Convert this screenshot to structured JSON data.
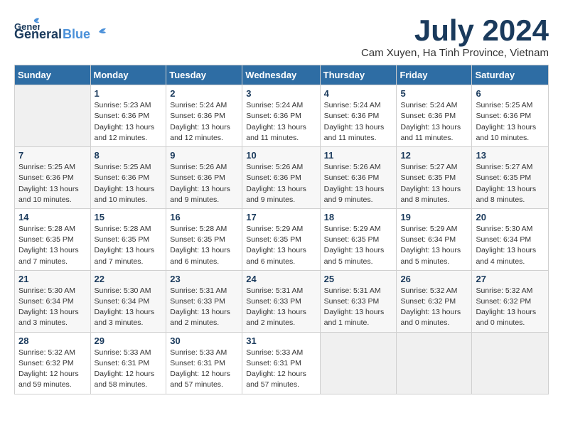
{
  "header": {
    "logo_general": "General",
    "logo_blue": "Blue",
    "month_title": "July 2024",
    "subtitle": "Cam Xuyen, Ha Tinh Province, Vietnam"
  },
  "columns": [
    "Sunday",
    "Monday",
    "Tuesday",
    "Wednesday",
    "Thursday",
    "Friday",
    "Saturday"
  ],
  "weeks": [
    [
      {
        "day": "",
        "info": ""
      },
      {
        "day": "1",
        "info": "Sunrise: 5:23 AM\nSunset: 6:36 PM\nDaylight: 13 hours\nand 12 minutes."
      },
      {
        "day": "2",
        "info": "Sunrise: 5:24 AM\nSunset: 6:36 PM\nDaylight: 13 hours\nand 12 minutes."
      },
      {
        "day": "3",
        "info": "Sunrise: 5:24 AM\nSunset: 6:36 PM\nDaylight: 13 hours\nand 11 minutes."
      },
      {
        "day": "4",
        "info": "Sunrise: 5:24 AM\nSunset: 6:36 PM\nDaylight: 13 hours\nand 11 minutes."
      },
      {
        "day": "5",
        "info": "Sunrise: 5:24 AM\nSunset: 6:36 PM\nDaylight: 13 hours\nand 11 minutes."
      },
      {
        "day": "6",
        "info": "Sunrise: 5:25 AM\nSunset: 6:36 PM\nDaylight: 13 hours\nand 10 minutes."
      }
    ],
    [
      {
        "day": "7",
        "info": "Sunrise: 5:25 AM\nSunset: 6:36 PM\nDaylight: 13 hours\nand 10 minutes."
      },
      {
        "day": "8",
        "info": "Sunrise: 5:25 AM\nSunset: 6:36 PM\nDaylight: 13 hours\nand 10 minutes."
      },
      {
        "day": "9",
        "info": "Sunrise: 5:26 AM\nSunset: 6:36 PM\nDaylight: 13 hours\nand 9 minutes."
      },
      {
        "day": "10",
        "info": "Sunrise: 5:26 AM\nSunset: 6:36 PM\nDaylight: 13 hours\nand 9 minutes."
      },
      {
        "day": "11",
        "info": "Sunrise: 5:26 AM\nSunset: 6:36 PM\nDaylight: 13 hours\nand 9 minutes."
      },
      {
        "day": "12",
        "info": "Sunrise: 5:27 AM\nSunset: 6:35 PM\nDaylight: 13 hours\nand 8 minutes."
      },
      {
        "day": "13",
        "info": "Sunrise: 5:27 AM\nSunset: 6:35 PM\nDaylight: 13 hours\nand 8 minutes."
      }
    ],
    [
      {
        "day": "14",
        "info": "Sunrise: 5:28 AM\nSunset: 6:35 PM\nDaylight: 13 hours\nand 7 minutes."
      },
      {
        "day": "15",
        "info": "Sunrise: 5:28 AM\nSunset: 6:35 PM\nDaylight: 13 hours\nand 7 minutes."
      },
      {
        "day": "16",
        "info": "Sunrise: 5:28 AM\nSunset: 6:35 PM\nDaylight: 13 hours\nand 6 minutes."
      },
      {
        "day": "17",
        "info": "Sunrise: 5:29 AM\nSunset: 6:35 PM\nDaylight: 13 hours\nand 6 minutes."
      },
      {
        "day": "18",
        "info": "Sunrise: 5:29 AM\nSunset: 6:35 PM\nDaylight: 13 hours\nand 5 minutes."
      },
      {
        "day": "19",
        "info": "Sunrise: 5:29 AM\nSunset: 6:34 PM\nDaylight: 13 hours\nand 5 minutes."
      },
      {
        "day": "20",
        "info": "Sunrise: 5:30 AM\nSunset: 6:34 PM\nDaylight: 13 hours\nand 4 minutes."
      }
    ],
    [
      {
        "day": "21",
        "info": "Sunrise: 5:30 AM\nSunset: 6:34 PM\nDaylight: 13 hours\nand 3 minutes."
      },
      {
        "day": "22",
        "info": "Sunrise: 5:30 AM\nSunset: 6:34 PM\nDaylight: 13 hours\nand 3 minutes."
      },
      {
        "day": "23",
        "info": "Sunrise: 5:31 AM\nSunset: 6:33 PM\nDaylight: 13 hours\nand 2 minutes."
      },
      {
        "day": "24",
        "info": "Sunrise: 5:31 AM\nSunset: 6:33 PM\nDaylight: 13 hours\nand 2 minutes."
      },
      {
        "day": "25",
        "info": "Sunrise: 5:31 AM\nSunset: 6:33 PM\nDaylight: 13 hours\nand 1 minute."
      },
      {
        "day": "26",
        "info": "Sunrise: 5:32 AM\nSunset: 6:32 PM\nDaylight: 13 hours\nand 0 minutes."
      },
      {
        "day": "27",
        "info": "Sunrise: 5:32 AM\nSunset: 6:32 PM\nDaylight: 13 hours\nand 0 minutes."
      }
    ],
    [
      {
        "day": "28",
        "info": "Sunrise: 5:32 AM\nSunset: 6:32 PM\nDaylight: 12 hours\nand 59 minutes."
      },
      {
        "day": "29",
        "info": "Sunrise: 5:33 AM\nSunset: 6:31 PM\nDaylight: 12 hours\nand 58 minutes."
      },
      {
        "day": "30",
        "info": "Sunrise: 5:33 AM\nSunset: 6:31 PM\nDaylight: 12 hours\nand 57 minutes."
      },
      {
        "day": "31",
        "info": "Sunrise: 5:33 AM\nSunset: 6:31 PM\nDaylight: 12 hours\nand 57 minutes."
      },
      {
        "day": "",
        "info": ""
      },
      {
        "day": "",
        "info": ""
      },
      {
        "day": "",
        "info": ""
      }
    ]
  ]
}
